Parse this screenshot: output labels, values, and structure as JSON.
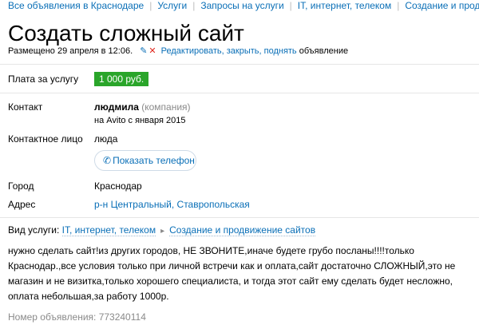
{
  "breadcrumbs": [
    "Все объявления в Краснодаре",
    "Услуги",
    "Запросы на услуги",
    "IT, интернет, телеком",
    "Создание и продвижение сайтов"
  ],
  "title": "Создать сложный сайт",
  "meta": {
    "posted": "Размещено 29 апреля в 12:06.",
    "actions": "Редактировать, закрыть, поднять",
    "tail": "объявление"
  },
  "price": {
    "label": "Плата за услугу",
    "value": "1 000 руб."
  },
  "contact": {
    "label": "Контакт",
    "name": "людмила",
    "type": "(компания)",
    "since": "на Avito с января 2015"
  },
  "person": {
    "label": "Контактное лицо",
    "value": "люда"
  },
  "phone_button": "Показать телефон",
  "city": {
    "label": "Город",
    "value": "Краснодар"
  },
  "address": {
    "label": "Адрес",
    "value": "р-н Центральный, Ставропольская"
  },
  "service": {
    "label": "Вид услуги:",
    "category": "IT, интернет, телеком",
    "subcategory": "Создание и продвижение сайтов"
  },
  "description": "нужно сделать сайт!из других городов, НЕ ЗВОНИТЕ,иначе будете грубо посланы!!!!только Краснодар.,все условия только при личной встречи как и оплата,сайт достаточно СЛОЖНЫЙ,это не магазин и не визитка,только хорошего специалиста, и тогда этот сайт ему сделать будет несложно, оплата небольшая,за работу 1000р.",
  "ad_number": "Номер объявления: 773240114",
  "colors": {
    "link": "#0a6fb7",
    "price_bg": "#2aa52a",
    "delete": "#e0241b"
  }
}
